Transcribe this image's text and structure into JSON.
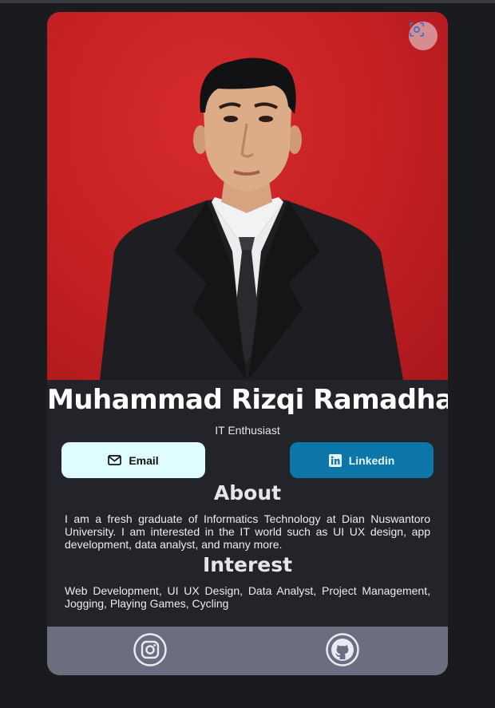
{
  "profile": {
    "name": "Muhammad Rizqi Ramadhan",
    "subtitle": "IT Enthusiast"
  },
  "buttons": {
    "email_label": "Email",
    "linkedin_label": "Linkedin"
  },
  "about": {
    "title": "About",
    "text": "I am a fresh graduate of Informatics Technology at Dian Nuswantoro University. I am interested in the IT world such as UI UX design, app development, data analyst, and many more."
  },
  "interest": {
    "title": "Interest",
    "text": "Web Development, UI UX Design, Data Analyst, Project Management, Jogging, Playing Games, Cycling"
  },
  "icons": {
    "scan": "scan-icon",
    "email": "mail-icon",
    "linkedin": "linkedin-icon",
    "instagram": "instagram-icon",
    "github": "github-icon"
  },
  "colors": {
    "page_bg": "#1a1b1f",
    "card_bg": "#232429",
    "photo_bg": "#c32024",
    "email_btn": "#dffdfe",
    "linkedin_btn": "#0c76a8",
    "footer_bg": "#6b6e7e"
  }
}
